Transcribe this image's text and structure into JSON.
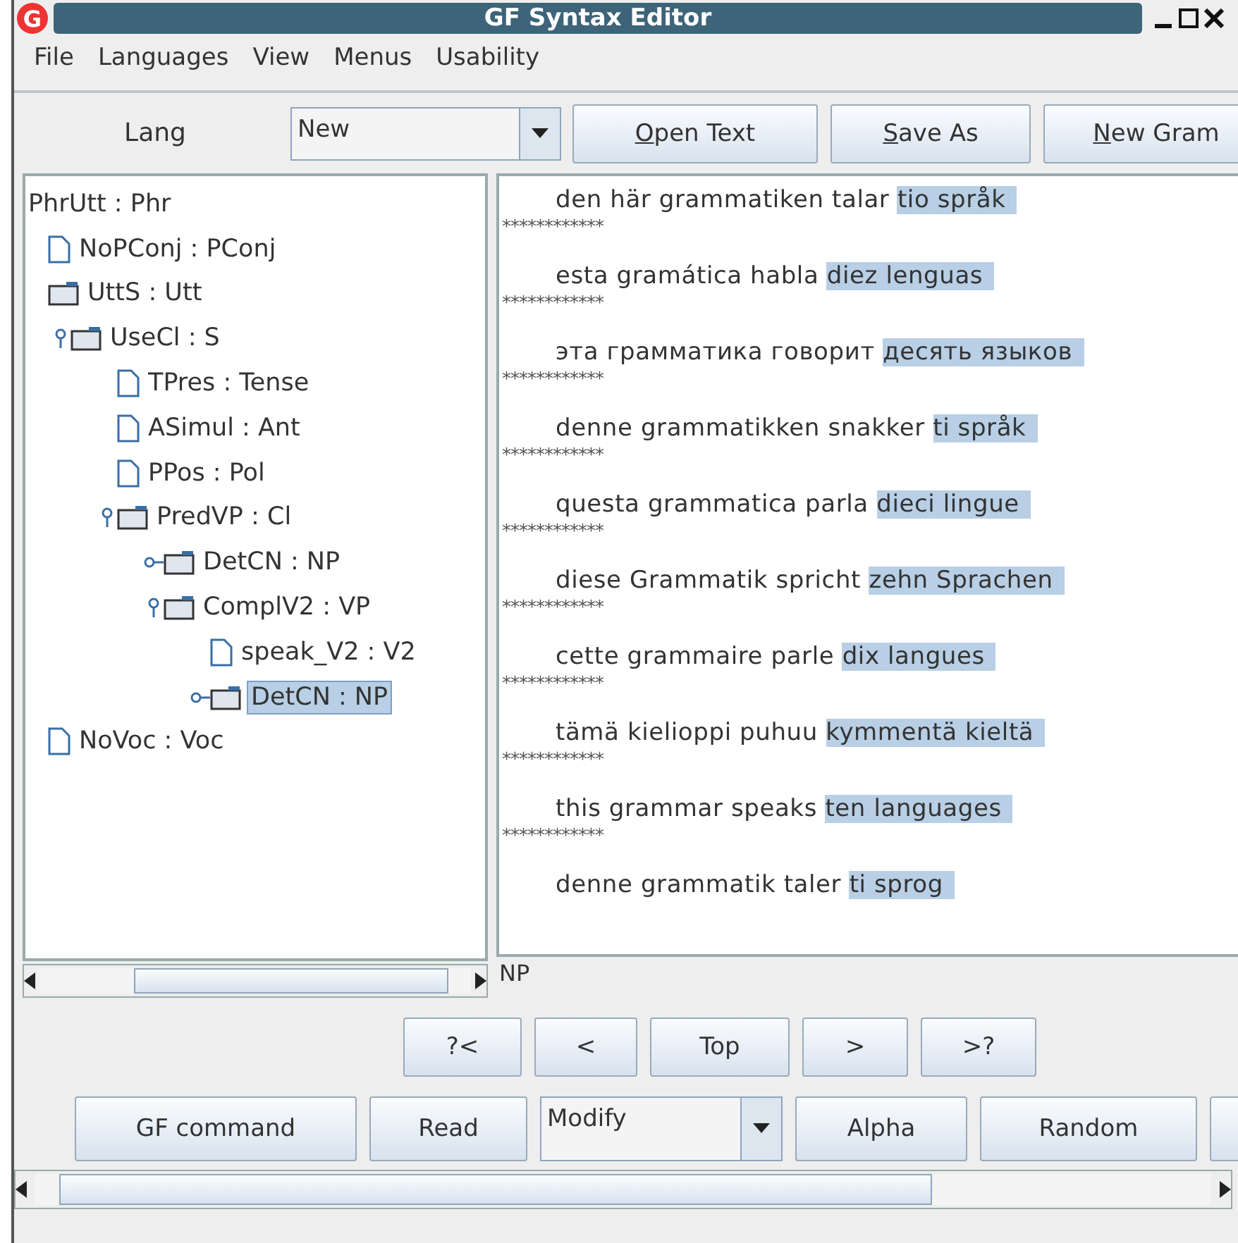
{
  "window": {
    "logo": "G",
    "title": "GF Syntax Editor"
  },
  "menu": [
    "File",
    "Languages",
    "View",
    "Menus",
    "Usability"
  ],
  "toolbar": {
    "label": "Lang",
    "combo": {
      "value": "New"
    },
    "buttons": [
      {
        "label": "Open Text",
        "mnemonic": true
      },
      {
        "label": "Save As",
        "mnemonic": true
      },
      {
        "label": "New Gram",
        "mnemonic": true
      }
    ]
  },
  "tree": {
    "label": "PhrUtt : Phr",
    "children": [
      {
        "label": "NoPConj : PConj",
        "kind": "leaf",
        "selected": false
      },
      {
        "label": "UttS : Utt",
        "kind": "node",
        "selected": false,
        "children": [
          {
            "label": "UseCl : S",
            "kind": "node",
            "expanded": true,
            "selected": false,
            "children": [
              {
                "label": "TPres : Tense",
                "kind": "leaf",
                "selected": false
              },
              {
                "label": "ASimul : Ant",
                "kind": "leaf",
                "selected": false
              },
              {
                "label": "PPos : Pol",
                "kind": "leaf",
                "selected": false
              },
              {
                "label": "PredVP : Cl",
                "kind": "node",
                "expanded": true,
                "selected": false,
                "children": [
                  {
                    "label": "DetCN : NP",
                    "kind": "node",
                    "expanded": false,
                    "selected": false
                  },
                  {
                    "label": "ComplV2 : VP",
                    "kind": "node",
                    "expanded": true,
                    "selected": false,
                    "children": [
                      {
                        "label": "speak_V2 : V2",
                        "kind": "leaf",
                        "selected": false
                      },
                      {
                        "label": "DetCN : NP",
                        "kind": "node",
                        "expanded": false,
                        "selected": true
                      }
                    ]
                  }
                ]
              }
            ]
          }
        ]
      },
      {
        "label": "NoVoc : Voc",
        "kind": "leaf",
        "selected": false
      }
    ]
  },
  "linearizations": [
    {
      "text": "den här grammatiken talar",
      "highlight": "tio språk",
      "separator": "************"
    },
    {
      "text": "esta gramática habla",
      "highlight": "diez lenguas",
      "separator": "************"
    },
    {
      "text": "эта грамматика говорит",
      "highlight": "десять языков",
      "separator": "************"
    },
    {
      "text": "denne grammatikken snakker",
      "highlight": "ti språk",
      "separator": "************"
    },
    {
      "text": "questa grammatica parla",
      "highlight": "dieci lingue",
      "separator": "************"
    },
    {
      "text": "diese Grammatik spricht",
      "highlight": "zehn Sprachen",
      "separator": "************"
    },
    {
      "text": "cette grammaire parle",
      "highlight": "dix langues",
      "separator": "************"
    },
    {
      "text": "tämä kielioppi puhuu",
      "highlight": "kymmentä kieltä",
      "separator": "************"
    },
    {
      "text": "this grammar speaks",
      "highlight": "ten languages",
      "separator": "************"
    },
    {
      "text": "denne grammatik taler",
      "highlight": "ti sprog"
    }
  ],
  "status": "NP",
  "navigation": [
    "?<",
    "<",
    "Top",
    ">",
    ">?"
  ],
  "commands": [
    {
      "kind": "button",
      "label": "GF command"
    },
    {
      "kind": "button",
      "label": "Read"
    },
    {
      "kind": "combo",
      "label": "Modify"
    },
    {
      "kind": "button",
      "label": "Alpha"
    },
    {
      "kind": "button",
      "label": "Random"
    },
    {
      "kind": "button"
    }
  ]
}
